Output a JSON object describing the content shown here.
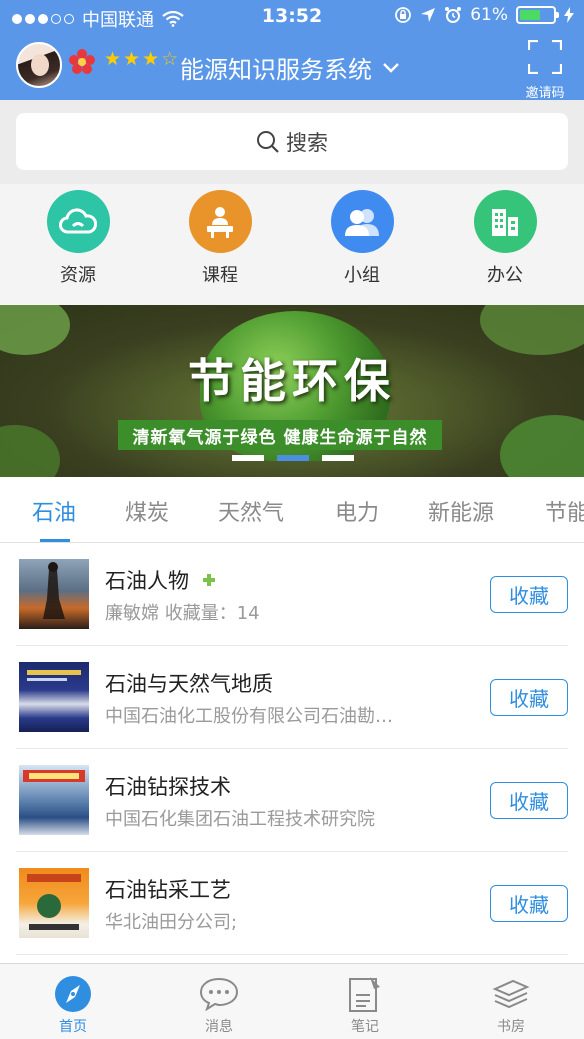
{
  "status_bar": {
    "carrier": "中国联通",
    "time": "13:52",
    "battery": "61%"
  },
  "header": {
    "title": "能源知识服务系统",
    "stars_filled": 3,
    "stars_total": 4,
    "invite_label": "邀请码"
  },
  "search": {
    "placeholder": "搜索"
  },
  "quick_nav": [
    {
      "label": "资源",
      "icon": "cloud-icon",
      "color": "#2ec4a6"
    },
    {
      "label": "课程",
      "icon": "lecture-icon",
      "color": "#e8942a"
    },
    {
      "label": "小组",
      "icon": "group-icon",
      "color": "#3f8bef"
    },
    {
      "label": "办公",
      "icon": "building-icon",
      "color": "#36c47a"
    }
  ],
  "banner": {
    "title": "节能环保",
    "subtitle": "清新氧气源于绿色  健康生命源于自然",
    "pages": 3,
    "active_page": 2
  },
  "categories": {
    "tabs": [
      "石油",
      "煤炭",
      "天然气",
      "电力",
      "新能源",
      "节能"
    ],
    "active": "石油"
  },
  "list": [
    {
      "title": "石油人物",
      "subtitle": "廉敏嫦    收藏量：14",
      "has_badge": true,
      "button": "收藏"
    },
    {
      "title": "石油与天然气地质",
      "subtitle": "中国石油化工股份有限公司石油勘…",
      "has_badge": false,
      "button": "收藏"
    },
    {
      "title": "石油钻探技术",
      "subtitle": "中国石化集团石油工程技术研究院",
      "has_badge": false,
      "button": "收藏"
    },
    {
      "title": "石油钻采工艺",
      "subtitle": "华北油田分公司;",
      "has_badge": false,
      "button": "收藏"
    }
  ],
  "bottom_nav": [
    {
      "label": "首页",
      "icon": "compass-icon",
      "active": true
    },
    {
      "label": "消息",
      "icon": "chat-bubble-icon",
      "active": false
    },
    {
      "label": "笔记",
      "icon": "note-icon",
      "active": false
    },
    {
      "label": "书房",
      "icon": "books-icon",
      "active": false
    }
  ],
  "colors": {
    "header_blue": "#5a97e8",
    "accent_blue": "#2f8ee0"
  }
}
